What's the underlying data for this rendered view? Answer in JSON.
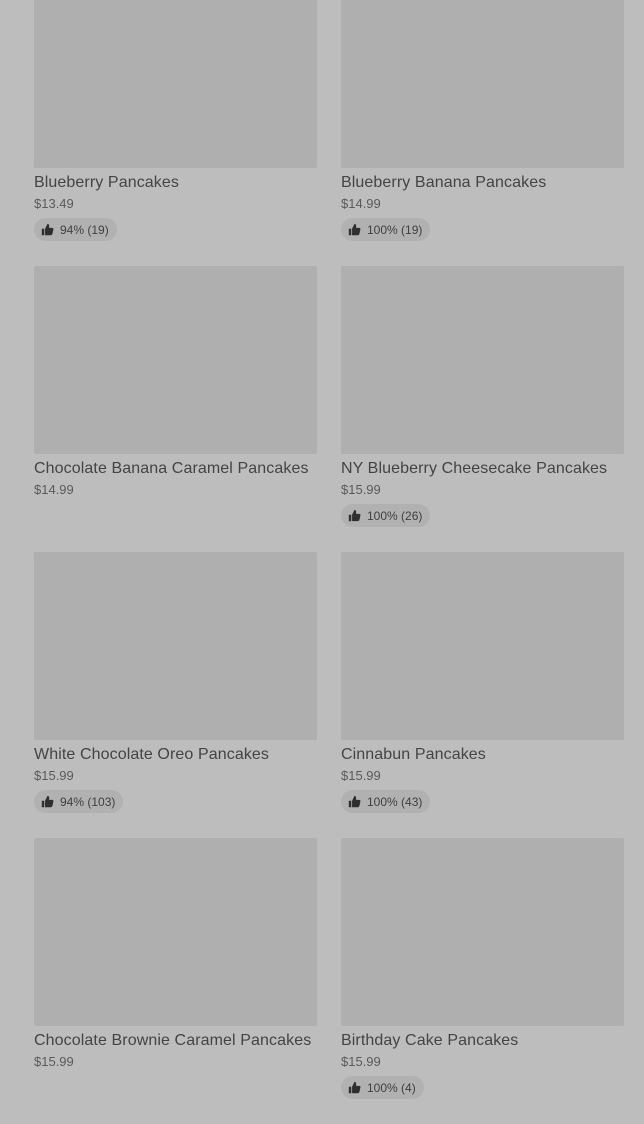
{
  "products": [
    {
      "title": "Blueberry Pancakes",
      "price": "$13.49",
      "rating": "94% (19)",
      "has_rating": true
    },
    {
      "title": "Blueberry Banana Pancakes",
      "price": "$14.99",
      "rating": "100% (19)",
      "has_rating": true
    },
    {
      "title": "Chocolate Banana Caramel Pancakes",
      "price": "$14.99",
      "rating": "",
      "has_rating": false
    },
    {
      "title": "NY Blueberry Cheesecake Pancakes",
      "price": "$15.99",
      "rating": "100% (26)",
      "has_rating": true
    },
    {
      "title": "White Chocolate Oreo Pancakes",
      "price": "$15.99",
      "rating": "94% (103)",
      "has_rating": true
    },
    {
      "title": "Cinnabun Pancakes",
      "price": "$15.99",
      "rating": "100% (43)",
      "has_rating": true
    },
    {
      "title": "Chocolate Brownie Caramel Pancakes",
      "price": "$15.99",
      "rating": "",
      "has_rating": false
    },
    {
      "title": "Birthday Cake Pancakes",
      "price": "$15.99",
      "rating": "100% (4)",
      "has_rating": true
    }
  ],
  "icons": {
    "rating_icon": "thumbs-up-icon"
  },
  "colors": {
    "background": "#bdbdbd",
    "thumbnail": "#afafaf",
    "rating_pill": "#b1b1b1",
    "title_text": "#444444"
  }
}
